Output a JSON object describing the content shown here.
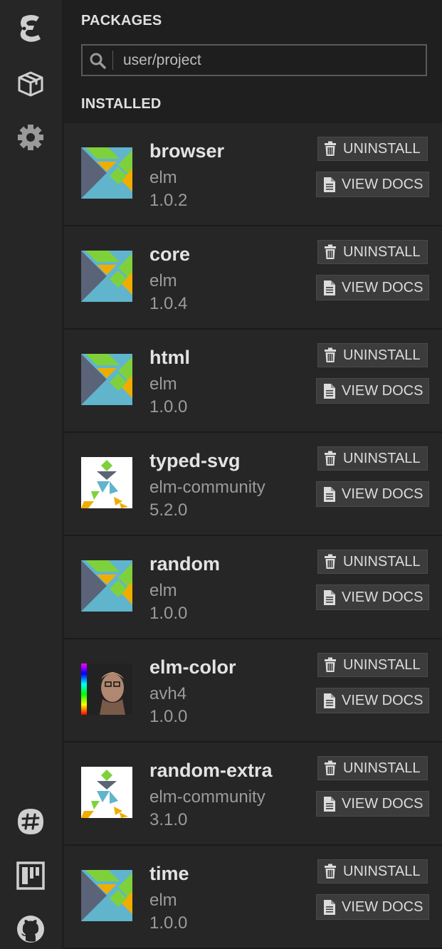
{
  "sidebar": {
    "icons": [
      "elm-logo-icon",
      "package-icon",
      "gear-icon",
      "slack-icon",
      "trello-icon",
      "github-icon"
    ]
  },
  "packages_header": "PACKAGES",
  "search": {
    "value": "user/project"
  },
  "installed_header": "INSTALLED",
  "buttons": {
    "uninstall": "UNINSTALL",
    "view_docs": "VIEW DOCS"
  },
  "packages": [
    {
      "name": "browser",
      "author": "elm",
      "version": "1.0.2",
      "logo": "elm-tangram-icon"
    },
    {
      "name": "core",
      "author": "elm",
      "version": "1.0.4",
      "logo": "elm-tangram-icon"
    },
    {
      "name": "html",
      "author": "elm",
      "version": "1.0.0",
      "logo": "elm-tangram-icon"
    },
    {
      "name": "typed-svg",
      "author": "elm-community",
      "version": "5.2.0",
      "logo": "elm-community-runner-icon"
    },
    {
      "name": "random",
      "author": "elm",
      "version": "1.0.0",
      "logo": "elm-tangram-icon"
    },
    {
      "name": "elm-color",
      "author": "avh4",
      "version": "1.0.0",
      "logo": "author-avatar"
    },
    {
      "name": "random-extra",
      "author": "elm-community",
      "version": "3.1.0",
      "logo": "elm-community-runner-icon"
    },
    {
      "name": "time",
      "author": "elm",
      "version": "1.0.0",
      "logo": "elm-tangram-icon"
    }
  ],
  "colors": {
    "elm_green": "#7fd13b",
    "elm_orange": "#f0ad00",
    "elm_blue": "#60b5cc",
    "elm_slate": "#5a6378"
  }
}
